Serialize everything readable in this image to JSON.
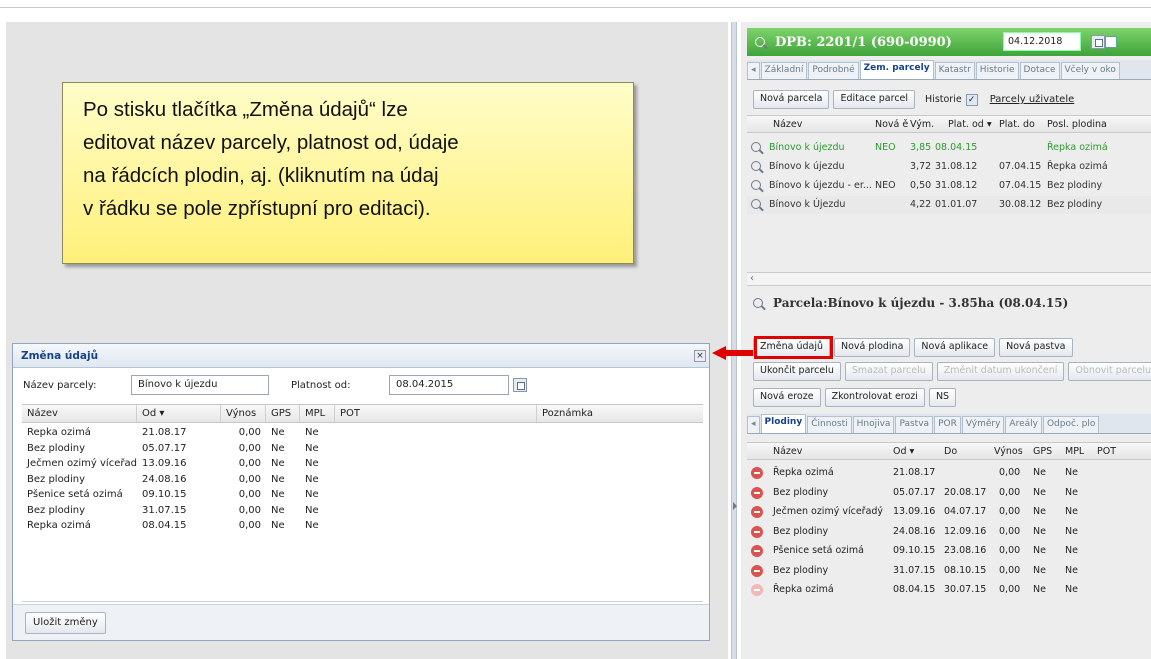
{
  "callout": {
    "lines": [
      "Po stisku tlačítka „Změna údajů“ lze",
      "editovat název parcely, platnost od, údaje",
      "na řádcích plodin, aj. (kliknutím na údaj",
      "v řádku se pole zpřístupní pro editaci)."
    ]
  },
  "dialog": {
    "title": "Změna údajů",
    "close": "×",
    "name_label": "Název parcely:",
    "name_value": "Bínovo k újezdu",
    "valid_label": "Platnost od:",
    "valid_value": "08.04.2015",
    "columns": [
      "Název",
      "Od ▾",
      "Výnos",
      "GPS",
      "MPL",
      "POT",
      "Poznámka"
    ],
    "rows": [
      [
        "Řepka ozimá",
        "21.08.17",
        "0,00",
        "Ne",
        "Ne"
      ],
      [
        "Bez plodiny",
        "05.07.17",
        "0,00",
        "Ne",
        "Ne"
      ],
      [
        "Ječmen ozimý víceřadý",
        "13.09.16",
        "0,00",
        "Ne",
        "Ne"
      ],
      [
        "Bez plodiny",
        "24.08.16",
        "0,00",
        "Ne",
        "Ne"
      ],
      [
        "Pšenice setá ozimá",
        "09.10.15",
        "0,00",
        "Ne",
        "Ne"
      ],
      [
        "Bez plodiny",
        "31.07.15",
        "0,00",
        "Ne",
        "Ne"
      ],
      [
        "Řepka ozimá",
        "08.04.15",
        "0,00",
        "Ne",
        "Ne"
      ]
    ],
    "save_label": "Uložit změny"
  },
  "right": {
    "header_title": "DPB: 2201/1 (690-0990)",
    "header_date": "04.12.2018",
    "tabs": [
      "Základní",
      "Podrobné",
      "Zem. parcely",
      "Katastr",
      "Historie",
      "Dotace",
      "Včely v oko"
    ],
    "active_tab": "Zem. parcely",
    "new_parcel": "Nová parcela",
    "edit_parcel": "Editace parcel",
    "history_label": "Historie",
    "user_parcels": "Parcely uživatele",
    "parcel_columns": [
      "Název",
      "Nová ě",
      "Vým.",
      "Plat. od ▾",
      "Plat. do",
      "Posl. plodina"
    ],
    "parcel_rows": [
      {
        "name": "Bínovo k újezdu",
        "nova": "NEO",
        "vym": "3,85",
        "od": "08.04.15",
        "do": "",
        "crop": "Řepka ozimá",
        "green": true
      },
      {
        "name": "Bínovo k újezdu",
        "nova": "",
        "vym": "3,72",
        "od": "31.08.12",
        "do": "07.04.15",
        "crop": "Řepka ozimá",
        "green": false
      },
      {
        "name": "Bínovo k újezdu - er...",
        "nova": "NEO",
        "vym": "0,50",
        "od": "31.08.12",
        "do": "07.04.15",
        "crop": "Bez plodiny",
        "green": false
      },
      {
        "name": "Bínovo k Újezdu",
        "nova": "",
        "vym": "4,22",
        "od": "01.01.07",
        "do": "30.08.12",
        "crop": "Bez plodiny",
        "green": false
      }
    ],
    "parcel_title": "Parcela:Bínovo k újezdu - 3.85ha (08.04.15)",
    "buttons_row1": [
      "Změna údajů",
      "Nová plodina",
      "Nová aplikace",
      "Nová pastva"
    ],
    "buttons_row2": [
      "Ukončit parcelu",
      "Smazat parcelu",
      "Změnit datum ukončení",
      "Obnovit parcelu"
    ],
    "buttons_row3": [
      "Nová eroze",
      "Zkontrolovat erozi",
      "NS"
    ],
    "lower_tabs": [
      "Plodiny",
      "Činnosti",
      "Hnojiva",
      "Pastva",
      "POR",
      "Výměry",
      "Areály",
      "Odpoč. plo"
    ],
    "crop_columns": [
      "Název",
      "Od ▾",
      "Do",
      "Výnos",
      "GPS",
      "MPL",
      "POT"
    ],
    "crop_rows": [
      [
        "Řepka ozimá",
        "21.08.17",
        "",
        "0,00",
        "Ne",
        "Ne"
      ],
      [
        "Bez plodiny",
        "05.07.17",
        "20.08.17",
        "0,00",
        "Ne",
        "Ne"
      ],
      [
        "Ječmen ozimý víceřadý",
        "13.09.16",
        "04.07.17",
        "0,00",
        "Ne",
        "Ne"
      ],
      [
        "Bez plodiny",
        "24.08.16",
        "12.09.16",
        "0,00",
        "Ne",
        "Ne"
      ],
      [
        "Pšenice setá ozimá",
        "09.10.15",
        "23.08.16",
        "0,00",
        "Ne",
        "Ne"
      ],
      [
        "Bez plodiny",
        "31.07.15",
        "08.10.15",
        "0,00",
        "Ne",
        "Ne"
      ],
      [
        "Řepka ozimá",
        "08.04.15",
        "30.07.15",
        "0,00",
        "Ne",
        "Ne"
      ]
    ]
  }
}
